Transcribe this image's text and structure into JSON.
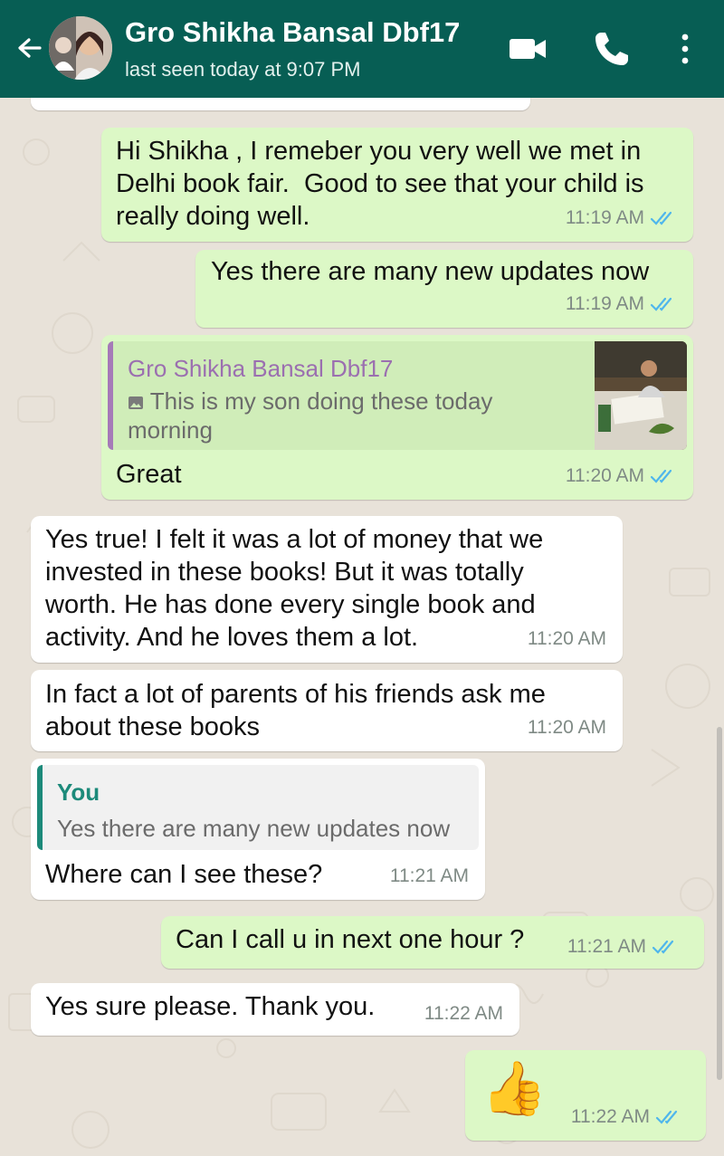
{
  "header": {
    "contact_name": "Gro Shikha Bansal Dbf17",
    "status": "last seen today at 9:07 PM",
    "icons": [
      "back-arrow-icon",
      "video-call-icon",
      "phone-icon",
      "more-vert-icon"
    ],
    "background_color": "#075e54"
  },
  "colors": {
    "outgoing_bubble": "#dcf8c6",
    "incoming_bubble": "#ffffff",
    "read_ticks": "#4fb6ec",
    "chat_background": "#e8e2d9"
  },
  "messages": [
    {
      "direction": "out",
      "text": "Hi Shikha , I remeber you very well we met in Delhi book fair.  Good to see that your child is really doing well.",
      "time": "11:19 AM",
      "status": "read"
    },
    {
      "direction": "out",
      "text": "Yes there are many new updates now",
      "time": "11:19 AM",
      "status": "read"
    },
    {
      "direction": "out",
      "quote": {
        "sender": "Gro Shikha Bansal Dbf17",
        "text": "This is my son doing these today morning",
        "has_photo": true,
        "icon": "photo-icon"
      },
      "text": "Great",
      "time": "11:20 AM",
      "status": "read"
    },
    {
      "direction": "in",
      "text": "Yes true! I felt it was a lot of money that we invested in these books! But it was totally worth. He has done every single book and activity. And he loves them a lot.",
      "time": "11:20 AM"
    },
    {
      "direction": "in",
      "text": "In fact a lot of parents of his friends ask me about these books",
      "time": "11:20 AM"
    },
    {
      "direction": "in",
      "quote": {
        "sender": "You",
        "text": "Yes there are many new updates now"
      },
      "text": "Where can I see these?",
      "time": "11:21 AM"
    },
    {
      "direction": "out",
      "text": "Can I call u in next one hour ?",
      "time": "11:21 AM",
      "status": "read"
    },
    {
      "direction": "in",
      "text": "Yes sure please. Thank you.",
      "time": "11:22 AM"
    },
    {
      "direction": "out",
      "emoji": "👍",
      "text": "",
      "time": "11:22 AM",
      "status": "read"
    }
  ]
}
